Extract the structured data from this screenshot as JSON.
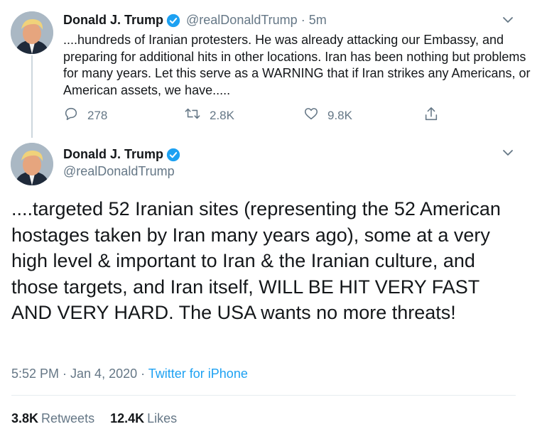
{
  "tweet1": {
    "name": "Donald J. Trump",
    "handle": "@realDonaldTrump",
    "separator": "·",
    "time": "5m",
    "text": "....hundreds of Iranian protesters. He was already attacking our Embassy, and preparing for additional hits in other locations. Iran has been nothing but problems for many years. Let this serve as a WARNING that if Iran strikes any Americans, or American assets, we have.....",
    "replies": "278",
    "retweets": "2.8K",
    "likes": "9.8K"
  },
  "tweet2": {
    "name": "Donald J. Trump",
    "handle": "@realDonaldTrump",
    "text": "....targeted 52 Iranian sites (representing the 52 American hostages taken by Iran many years ago), some at a very high level & important to Iran &  the Iranian culture, and those targets, and Iran itself, WILL BE HIT VERY FAST AND VERY HARD. The USA wants no more threats!",
    "timestamp": "5:52 PM · Jan 4, 2020 · ",
    "source": "Twitter for iPhone",
    "retweets_count": "3.8K",
    "retweets_label": "Retweets",
    "likes_count": "12.4K",
    "likes_label": "Likes"
  },
  "icons": {
    "verified": "verified-badge-icon",
    "menu": "chevron-down-icon",
    "reply": "reply-icon",
    "retweet": "retweet-icon",
    "like": "heart-icon",
    "share": "share-icon"
  },
  "colors": {
    "verified": "#1da1f2",
    "secondary_text": "#657786",
    "link": "#1da1f2",
    "thread_line": "#ccd6dd"
  }
}
